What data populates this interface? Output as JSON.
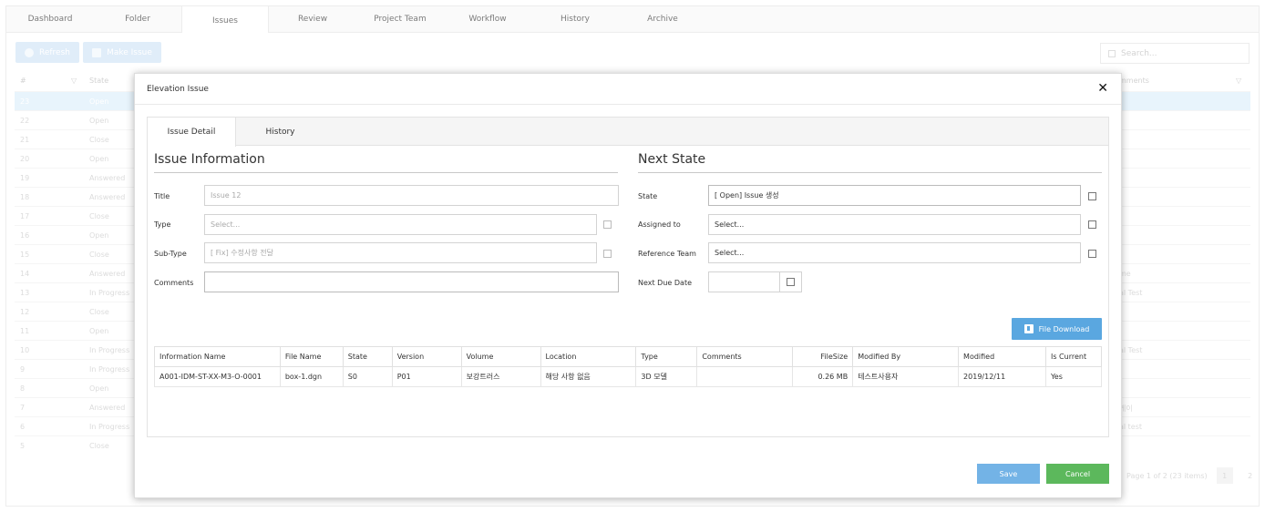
{
  "nav": {
    "tabs": [
      "Dashboard",
      "Folder",
      "Issues",
      "Review",
      "Project Team",
      "Workflow",
      "History",
      "Archive"
    ],
    "active": "Issues"
  },
  "background": {
    "refresh_label": "Refresh",
    "make_issue_label": "Make Issue",
    "search_placeholder": "Search...",
    "header": {
      "num": "#",
      "state": "State",
      "comments": "mments"
    },
    "rows": [
      {
        "n": "23",
        "s": "Open",
        "r": "",
        "selected": true
      },
      {
        "n": "22",
        "s": "Open",
        "r": ""
      },
      {
        "n": "21",
        "s": "Close",
        "r": ""
      },
      {
        "n": "20",
        "s": "Open",
        "r": ""
      },
      {
        "n": "19",
        "s": "Answered",
        "r": ""
      },
      {
        "n": "18",
        "s": "Answered",
        "r": ""
      },
      {
        "n": "17",
        "s": "Close",
        "r": ""
      },
      {
        "n": "16",
        "s": "Open",
        "r": ""
      },
      {
        "n": "15",
        "s": "Close",
        "r": ""
      },
      {
        "n": "14",
        "s": "Answered",
        "r": "me"
      },
      {
        "n": "13",
        "s": "In Progress",
        "r": "al Test"
      },
      {
        "n": "12",
        "s": "Close",
        "r": ""
      },
      {
        "n": "11",
        "s": "Open",
        "r": ""
      },
      {
        "n": "10",
        "s": "In Progress",
        "r": "al Test"
      },
      {
        "n": "9",
        "s": "In Progress",
        "r": ""
      },
      {
        "n": "8",
        "s": "Open",
        "r": ""
      },
      {
        "n": "7",
        "s": "Answered",
        "r": "케이"
      },
      {
        "n": "6",
        "s": "In Progress",
        "r": "al test"
      },
      {
        "n": "5",
        "s": "Close",
        "r": ""
      }
    ],
    "pager": {
      "text": "Page 1 of 2 (23 items)",
      "pages": [
        "1",
        "2"
      ]
    }
  },
  "modal": {
    "title": "Elevation Issue",
    "close_glyph": "✕",
    "tabs": [
      "Issue Detail",
      "History"
    ],
    "issue_info": {
      "heading": "Issue Information",
      "title_label": "Title",
      "title_value": "Issue 12",
      "type_label": "Type",
      "type_value": "Select...",
      "subtype_label": "Sub-Type",
      "subtype_value": "[ Fix] 수정사항 전달",
      "comments_label": "Comments",
      "comments_value": ""
    },
    "next_state": {
      "heading": "Next State",
      "state_label": "State",
      "state_value": "[ Open] Issue 생성",
      "assigned_label": "Assigned to",
      "assigned_value": "Select...",
      "refteam_label": "Reference Team",
      "refteam_value": "Select...",
      "duedate_label": "Next Due Date",
      "duedate_value": ""
    },
    "file_download_label": "File Download",
    "file_table": {
      "headers": [
        "Information Name",
        "File Name",
        "State",
        "Version",
        "Volume",
        "Location",
        "Type",
        "Comments",
        "FileSize",
        "Modified By",
        "Modified",
        "Is Current"
      ],
      "rows": [
        [
          "A001-IDM-ST-XX-M3-O-0001",
          "box-1.dgn",
          "S0",
          "P01",
          "보강트러스",
          "해당 사항 없음",
          "3D 모델",
          "",
          "0.26 MB",
          "테스트사용자",
          "2019/12/11",
          "Yes"
        ]
      ]
    },
    "save_label": "Save",
    "cancel_label": "Cancel"
  }
}
